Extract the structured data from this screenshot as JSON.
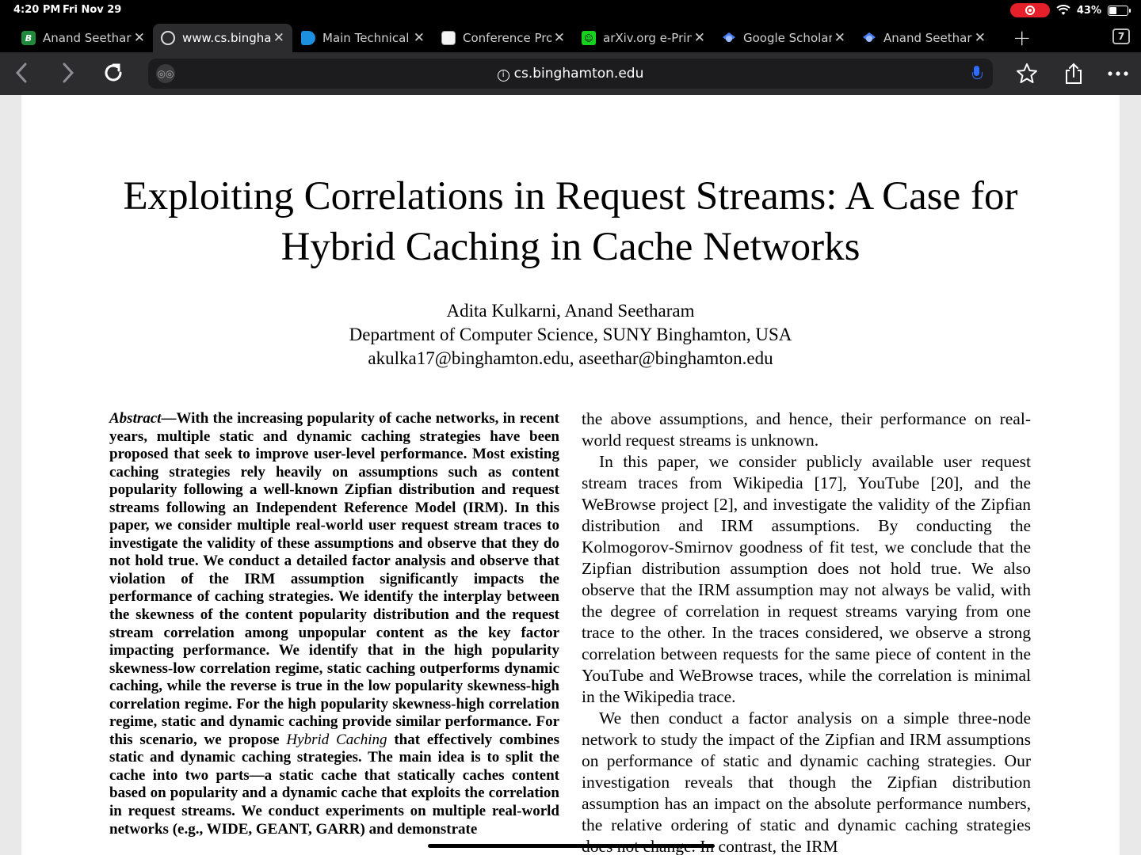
{
  "status_bar": {
    "time": "4:20 PM",
    "date": "Fri Nov 29",
    "battery_percent": "43%",
    "battery_level": 0.43
  },
  "tabs": [
    {
      "title": "Anand Seetharam",
      "favicon": "b-logo-icon",
      "active": false
    },
    {
      "title": "www.cs.binghamton.edu",
      "favicon": "globe-icon",
      "active": true
    },
    {
      "title": "Main Technical Program",
      "favicon": "edge-icon",
      "active": false
    },
    {
      "title": "Conference Program",
      "favicon": "document-icon",
      "active": false
    },
    {
      "title": "arXiv.org e-Print archive",
      "favicon": "arxiv-icon",
      "active": false
    },
    {
      "title": "Google Scholar",
      "favicon": "scholar-icon",
      "active": false
    },
    {
      "title": "Anand Seetharam",
      "favicon": "scholar-icon",
      "active": false
    }
  ],
  "tab_count": "7",
  "toolbar": {
    "url": "cs.binghamton.edu"
  },
  "paper": {
    "title": "Exploiting Correlations in Request Streams: A Case for Hybrid Caching in Cache Networks",
    "authors": "Adita Kulkarni, Anand Seetharam",
    "affiliation": "Department of Computer Science, SUNY Binghamton, USA",
    "emails": "akulka17@binghamton.edu, aseethar@binghamton.edu",
    "abstract_label": "Abstract",
    "abstract_part1": "—With the increasing popularity of cache networks, in recent years, multiple static and dynamic caching strategies have been proposed that seek to improve user-level performance. Most existing caching strategies rely heavily on assumptions such as content popularity following a well-known Zipfian distribution and request streams following an Independent Reference Model (IRM). In this paper, we consider multiple real-world user request stream traces to investigate the validity of these assumptions and observe that they do not hold true. We conduct a detailed factor analysis and observe that violation of the IRM assumption significantly impacts the performance of caching strategies. We identify the interplay between the skewness of the content popularity distribution and the request stream correlation among unpopular content as the key factor impacting performance. We identify that in the high popularity skewness-low correlation regime, static caching outperforms dynamic caching, while the reverse is true in the low popularity skewness-high correlation regime. For the high popularity skewness-high correlation regime, static and dynamic caching provide similar performance. For this scenario, we propose ",
    "abstract_emphasis": "Hybrid Caching",
    "abstract_part2": " that effectively combines static and dynamic caching strategies. The main idea is to split the cache into two parts—a static cache that statically caches content based on popularity and a dynamic cache that exploits the correlation in request streams. We conduct experiments on multiple real-world networks (e.g., WIDE, GEANT, GARR) and demonstrate",
    "right_col": [
      "the above assumptions, and hence, their performance on real-world request streams is unknown.",
      "In this paper, we consider publicly available user request stream traces from Wikipedia [17], YouTube [20], and the WeBrowse project [2], and investigate the validity of the Zipfian distribution and IRM assumptions. By conducting the Kolmogorov-Smirnov goodness of fit test, we conclude that the Zipfian distribution assumption does not hold true. We also observe that the IRM assumption may not always be valid, with the degree of correlation in request streams varying from one trace to the other. In the traces considered, we observe a strong correlation between requests for the same piece of content in the YouTube and WeBrowse traces, while the correlation is minimal in the Wikipedia trace.",
      "We then conduct a factor analysis on a simple three-node network to study the impact of the Zipfian and IRM assumptions on performance of static and dynamic caching strategies. Our investigation reveals that though the Zipfian distribution assumption has an impact on the absolute performance numbers, the relative ordering of static and dynamic caching strategies does not change. In contrast, the IRM"
    ]
  }
}
